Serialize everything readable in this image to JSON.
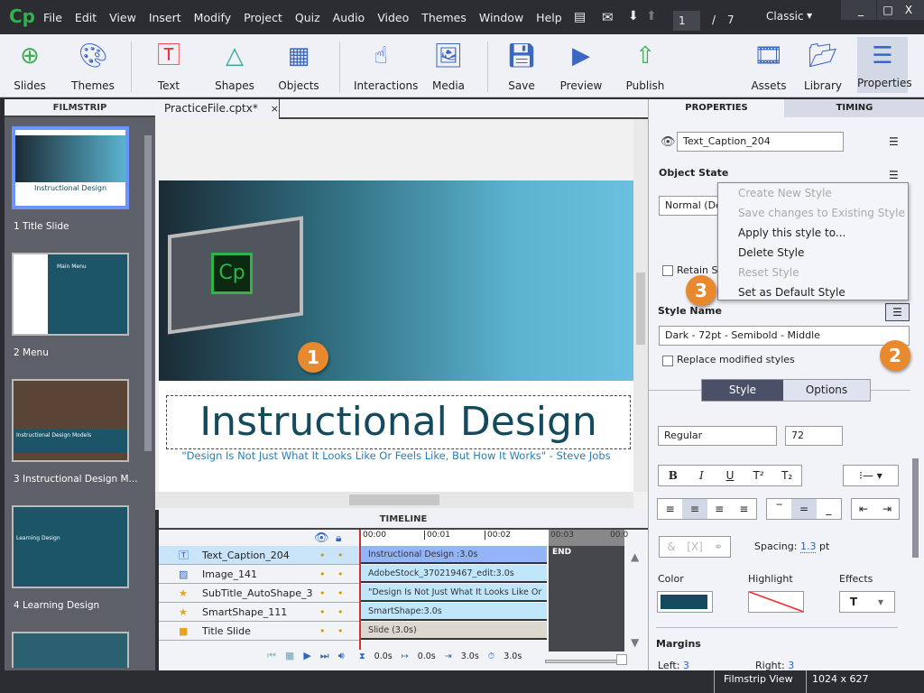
{
  "app": {
    "logo": "Cp",
    "menu": [
      "File",
      "Edit",
      "View",
      "Insert",
      "Modify",
      "Project",
      "Quiz",
      "Audio",
      "Video",
      "Themes",
      "Window",
      "Help"
    ],
    "page_current": "1",
    "page_sep": "/",
    "page_total": "7",
    "workspace": "Classic",
    "window_buttons": [
      "_",
      "□",
      "X"
    ]
  },
  "toolbar": {
    "items": [
      {
        "label": "Slides",
        "icon": "add-slide-icon"
      },
      {
        "label": "Themes",
        "icon": "palette-icon"
      },
      {
        "label": "Text",
        "icon": "text-icon"
      },
      {
        "label": "Shapes",
        "icon": "shapes-icon"
      },
      {
        "label": "Objects",
        "icon": "objects-icon"
      },
      {
        "label": "Interactions",
        "icon": "hand-icon"
      },
      {
        "label": "Media",
        "icon": "image-icon"
      },
      {
        "label": "Save",
        "icon": "save-icon"
      },
      {
        "label": "Preview",
        "icon": "play-icon"
      },
      {
        "label": "Publish",
        "icon": "publish-icon"
      },
      {
        "label": "Assets",
        "icon": "assets-icon"
      },
      {
        "label": "Library",
        "icon": "library-icon"
      },
      {
        "label": "Properties",
        "icon": "properties-icon"
      }
    ]
  },
  "filmstrip": {
    "title": "FILMSTRIP",
    "slides": [
      {
        "label": "1 Title Slide",
        "thumb_title": "Instructional Design"
      },
      {
        "label": "2 Menu",
        "thumb_title": "Main Menu"
      },
      {
        "label": "3 Instructional Design M...",
        "thumb_title": "Instructional Design Models"
      },
      {
        "label": "4 Learning Design",
        "thumb_title": "Learning Design"
      },
      {
        "label": "",
        "thumb_title": ""
      }
    ]
  },
  "document": {
    "tab": "PracticeFile.cptx*",
    "close": "×"
  },
  "slide": {
    "title": "Instructional Design",
    "subtitle": "\"Design Is Not Just What It Looks Like Or Feels Like, But How It Works\" - Steve Jobs",
    "logo": "Cp"
  },
  "timeline": {
    "title": "TIMELINE",
    "ticks": [
      "00:00",
      "00:01",
      "00:02",
      "00:03",
      "00:0"
    ],
    "end_label": "END",
    "rows": [
      {
        "name": "Text_Caption_204",
        "bar": "Instructional Design :3.0s",
        "icon": "text-caption-icon"
      },
      {
        "name": "Image_141",
        "bar": "AdobeStock_370219467_edit:3.0s",
        "icon": "image-icon"
      },
      {
        "name": "SubTitle_AutoShape_3",
        "bar": "\"Design Is Not Just What It Looks Like Or F...",
        "icon": "star-icon"
      },
      {
        "name": "SmartShape_111",
        "bar": "SmartShape:3.0s",
        "icon": "star-icon"
      },
      {
        "name": "Title Slide",
        "bar": "Slide (3.0s)",
        "icon": "slide-icon"
      }
    ],
    "readouts": [
      "0.0s",
      "0.0s",
      "3.0s",
      "3.0s"
    ]
  },
  "properties": {
    "tabs": [
      "PROPERTIES",
      "TIMING"
    ],
    "object_name": "Text_Caption_204",
    "object_state_label": "Object State",
    "state_value": "Normal (De",
    "retain_label": "Retain St",
    "style_name_label": "Style Name",
    "style_value": "Dark - 72pt - Semibold - Middle",
    "replace_label": "Replace modified styles",
    "subtabs": [
      "Style",
      "Options"
    ],
    "font_style": "Regular",
    "font_size": "72",
    "format_buttons": [
      "B",
      "I",
      "U",
      "T²",
      "T₂"
    ],
    "spacing_label": "Spacing:",
    "spacing_value": "1.3",
    "spacing_unit": "pt",
    "color_label": "Color",
    "highlight_label": "Highlight",
    "effects_label": "Effects",
    "effects_value": "T",
    "margins_label": "Margins",
    "left_label": "Left:",
    "left_value": "3",
    "right_label": "Right:",
    "right_value": "3",
    "text_color": "#134a5e"
  },
  "context_menu": [
    {
      "label": "Create New Style",
      "enabled": false
    },
    {
      "label": "Save changes to Existing Style",
      "enabled": false
    },
    {
      "label": "Apply this style to...",
      "enabled": true
    },
    {
      "label": "Delete Style",
      "enabled": true
    },
    {
      "label": "Reset Style",
      "enabled": false
    },
    {
      "label": "Set as Default Style",
      "enabled": true
    }
  ],
  "callouts": [
    "1",
    "2",
    "3"
  ],
  "status": {
    "view": "Filmstrip View",
    "size": "1024 x 627"
  }
}
